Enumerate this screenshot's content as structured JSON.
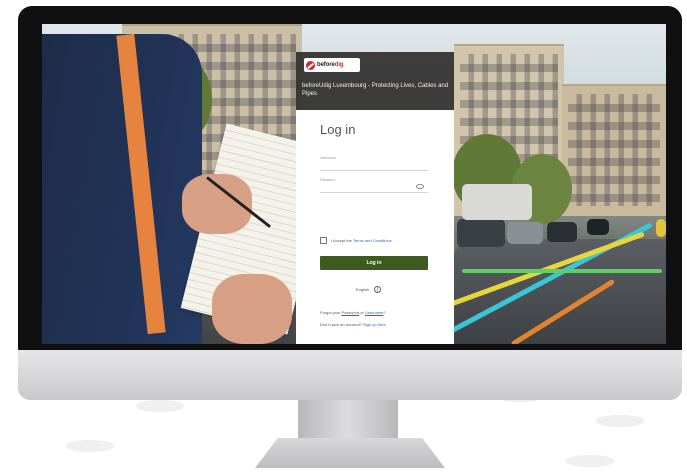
{
  "brand": {
    "logo_text": "before",
    "logo_text_highlight": "dig",
    "title": "beforeUdig Luxembourg - Protecting Lives, Cables and Pipes"
  },
  "login": {
    "heading": "Log in",
    "username_label": "Username",
    "password_label": "Password",
    "terms_prefix": "I Accept the ",
    "terms_link": "Terms and Conditions",
    "terms_suffix": ".",
    "button_label": "Log in",
    "language": "English",
    "forgot_prefix": "Forgot your ",
    "forgot_password": "Password",
    "forgot_or": " or ",
    "forgot_username": "Username",
    "forgot_suffix": "?",
    "signup_prefix": "Don't have an account? ",
    "signup_link": "Sign up here."
  },
  "colors": {
    "button": "#3e5a1f",
    "link": "#2a6bb8",
    "header_bg": "#282624",
    "logo_red": "#d22a2a"
  },
  "icons": [
    "globe-icon",
    "eye-icon",
    "checkbox"
  ]
}
